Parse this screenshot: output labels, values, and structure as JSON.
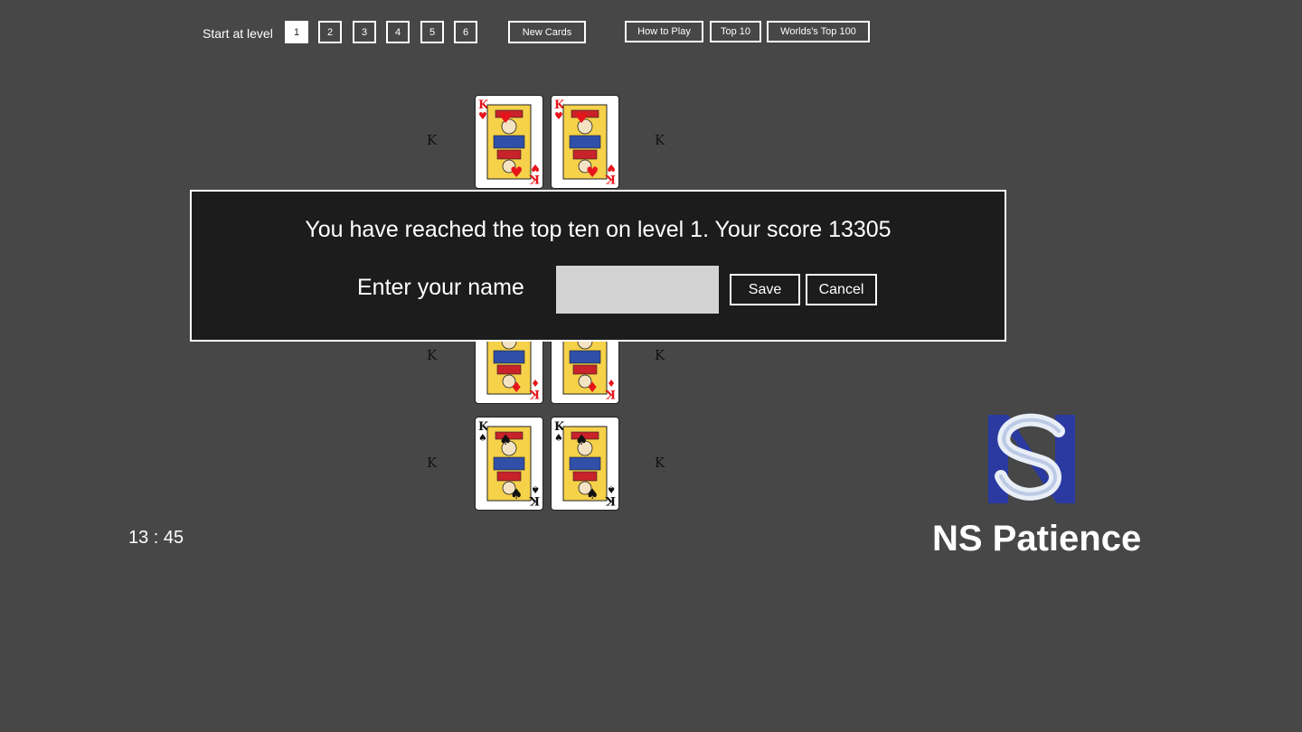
{
  "toolbar": {
    "start_label": "Start at level",
    "levels": [
      "1",
      "2",
      "3",
      "4",
      "5",
      "6"
    ],
    "active_level": "1",
    "new_cards": "New Cards",
    "how_to_play": "How to Play",
    "top10": "Top 10",
    "worlds_top": "Worlds's Top 100"
  },
  "board": {
    "side_letter": "K",
    "cards": [
      {
        "rank": "K",
        "suit": "hearts",
        "suit_glyph": "♥",
        "color": "#e8141b"
      },
      {
        "rank": "K",
        "suit": "hearts",
        "suit_glyph": "♥",
        "color": "#e8141b"
      },
      {
        "rank": "K",
        "suit": "diamonds",
        "suit_glyph": "♦",
        "color": "#e8141b"
      },
      {
        "rank": "K",
        "suit": "diamonds",
        "suit_glyph": "♦",
        "color": "#e8141b"
      },
      {
        "rank": "K",
        "suit": "spades",
        "suit_glyph": "♠",
        "color": "#111111"
      },
      {
        "rank": "K",
        "suit": "spades",
        "suit_glyph": "♠",
        "color": "#111111"
      }
    ]
  },
  "dialog": {
    "message": "You have reached the top ten on level 1. Your score 13305",
    "name_label": "Enter your name",
    "name_value": "",
    "save": "Save",
    "cancel": "Cancel"
  },
  "timer": "13 : 45",
  "brand": {
    "logo_text": "NS",
    "name": "NS Patience",
    "logo_color": "#2b3aa0"
  }
}
